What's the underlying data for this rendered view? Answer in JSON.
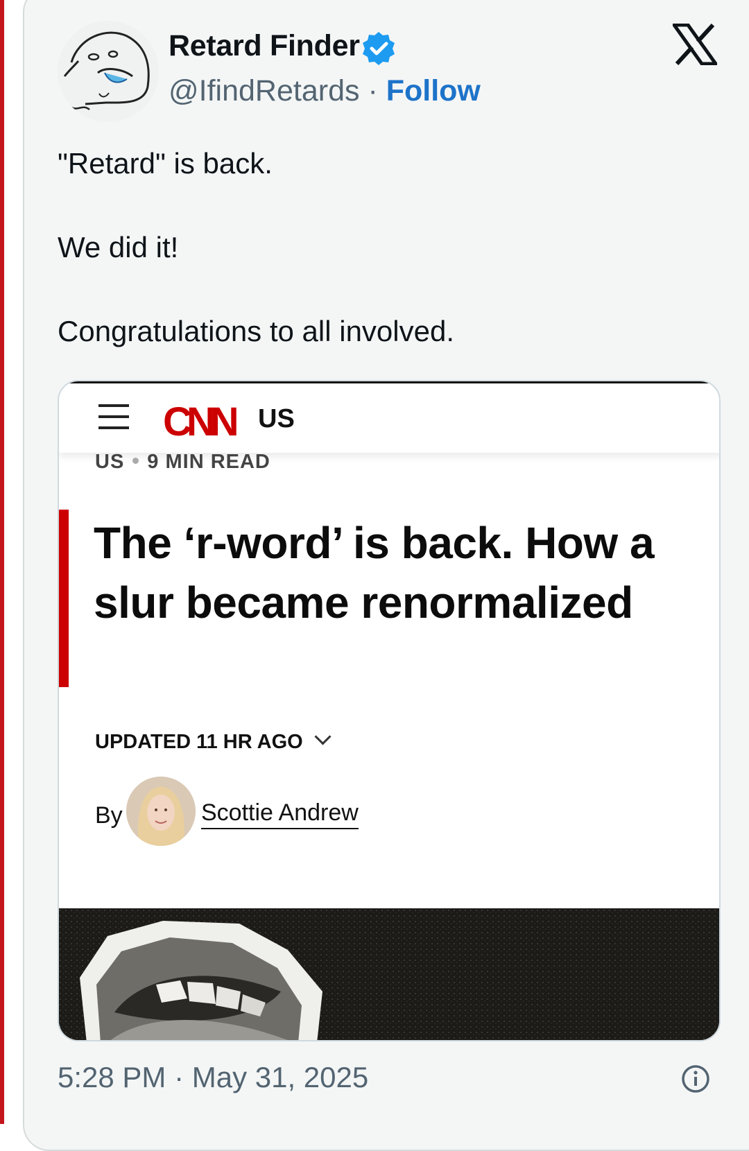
{
  "tweet": {
    "display_name": "Retard Finder",
    "handle": "@IfindRetards",
    "separator": "·",
    "follow_label": "Follow",
    "lines": [
      "\"Retard\" is back.",
      "We did it!",
      "Congratulations to all involved."
    ],
    "timestamp": "5:28 PM · May 31, 2025",
    "verified": true,
    "brand_icon": "x-logo-icon"
  },
  "embed": {
    "logo": "CNN",
    "edition": "US",
    "section": "US",
    "read_time": "9 MIN READ",
    "headline": "The ‘r-word’ is back. How a slur became renormalized",
    "updated": "UPDATED 11 HR AGO",
    "by": "By",
    "author": "Scottie Andrew"
  },
  "colors": {
    "follow": "#1d73c9",
    "verified": "#1d9bf0",
    "cnn_red": "#cc0000",
    "card_bg": "#f4f6f6",
    "muted_text": "#536471"
  }
}
